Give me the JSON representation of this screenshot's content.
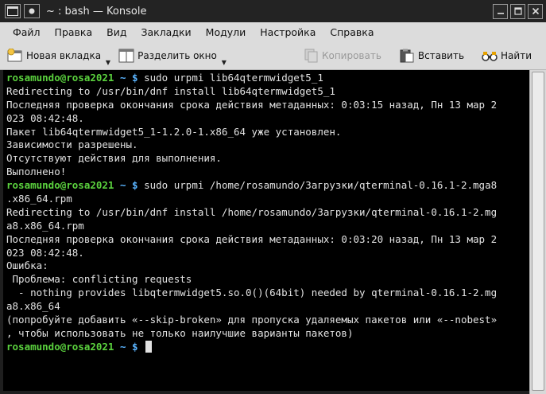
{
  "window": {
    "title": "~ : bash — Konsole"
  },
  "menu": [
    "Файл",
    "Правка",
    "Вид",
    "Закладки",
    "Модули",
    "Настройка",
    "Справка"
  ],
  "toolbar": {
    "new_tab": "Новая вкладка",
    "split_view": "Разделить окно",
    "copy": "Копировать",
    "paste": "Вставить",
    "find": "Найти"
  },
  "terminal": {
    "prompt_user": "rosamundo@rosa2021",
    "prompt_rest": " ~ $ ",
    "lines": [
      {
        "type": "prompt",
        "cmd": "sudo urpmi lib64qtermwidget5_1"
      },
      {
        "type": "out",
        "text": "Redirecting to /usr/bin/dnf install lib64qtermwidget5_1"
      },
      {
        "type": "out",
        "text": "Последняя проверка окончания срока действия метаданных: 0:03:15 назад, Пн 13 мар 2"
      },
      {
        "type": "out",
        "text": "023 08:42:48."
      },
      {
        "type": "out",
        "text": "Пакет lib64qtermwidget5_1-1.2.0-1.x86_64 уже установлен."
      },
      {
        "type": "out",
        "text": "Зависимости разрешены."
      },
      {
        "type": "out",
        "text": "Отсутствуют действия для выполнения."
      },
      {
        "type": "out",
        "text": "Выполнено!"
      },
      {
        "type": "prompt",
        "cmd": "sudo urpmi /home/rosamundo/Загрузки/qterminal-0.16.1-2.mga8"
      },
      {
        "type": "out",
        "text": ".x86_64.rpm"
      },
      {
        "type": "out",
        "text": "Redirecting to /usr/bin/dnf install /home/rosamundo/Загрузки/qterminal-0.16.1-2.mg"
      },
      {
        "type": "out",
        "text": "a8.x86_64.rpm"
      },
      {
        "type": "out",
        "text": "Последняя проверка окончания срока действия метаданных: 0:03:20 назад, Пн 13 мар 2"
      },
      {
        "type": "out",
        "text": "023 08:42:48."
      },
      {
        "type": "out",
        "text": "Ошибка:"
      },
      {
        "type": "out",
        "text": " Проблема: conflicting requests"
      },
      {
        "type": "out",
        "text": "  - nothing provides libqtermwidget5.so.0()(64bit) needed by qterminal-0.16.1-2.mg"
      },
      {
        "type": "out",
        "text": "a8.x86_64"
      },
      {
        "type": "out",
        "text": "(попробуйте добавить «--skip-broken» для пропуска удаляемых пакетов или «--nobest»"
      },
      {
        "type": "out",
        "text": ", чтобы использовать не только наилучшие варианты пакетов)"
      },
      {
        "type": "prompt_cursor",
        "cmd": ""
      }
    ]
  }
}
